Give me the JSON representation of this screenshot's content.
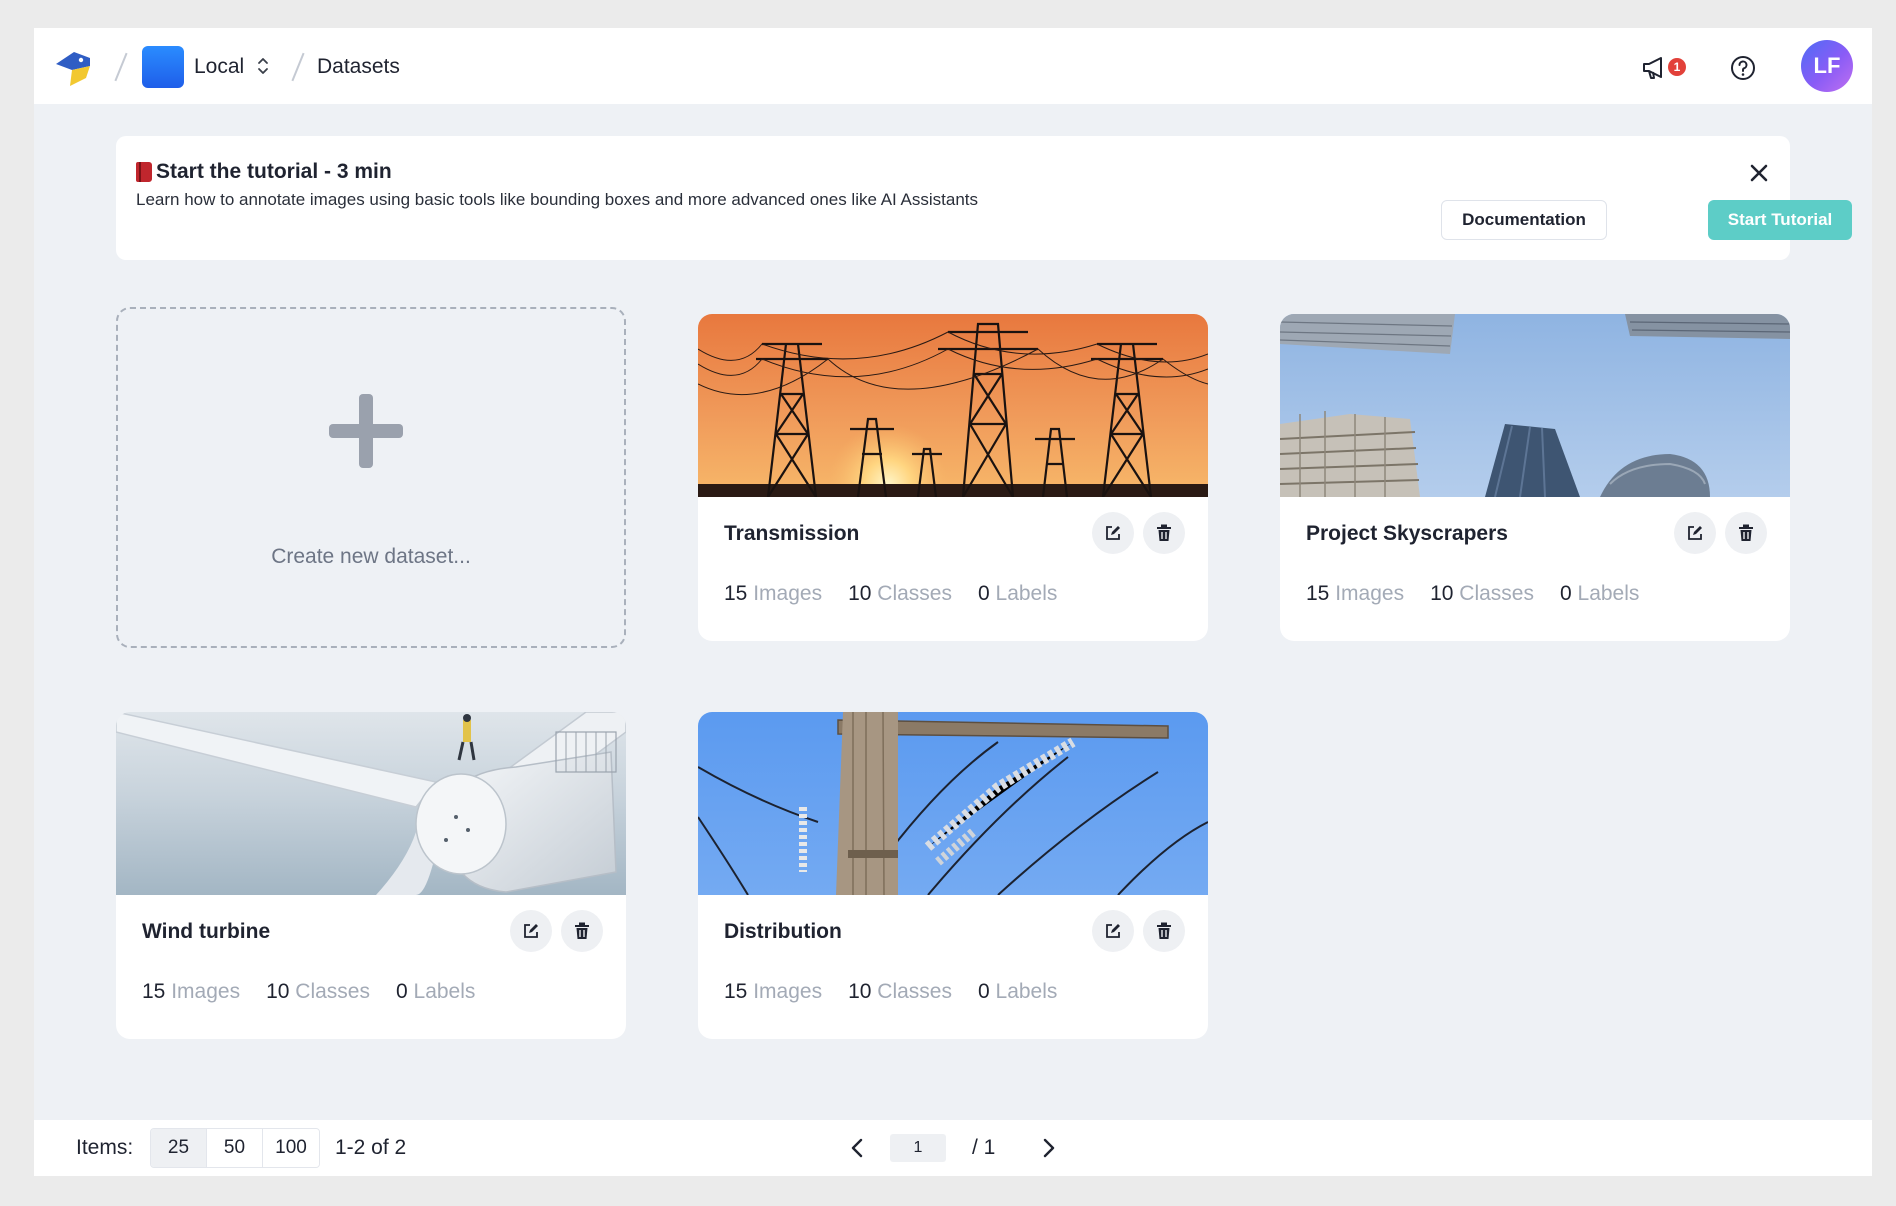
{
  "header": {
    "workspace": "Local",
    "breadcrumb": "Datasets",
    "notification_count": "1",
    "avatar_initials": "LF"
  },
  "banner": {
    "title": "Start the tutorial - 3 min",
    "description": "Learn how to annotate images using basic tools like bounding boxes and more advanced ones like AI Assistants",
    "documentation_label": "Documentation",
    "start_label": "Start Tutorial"
  },
  "create_tile": {
    "label": "Create new dataset..."
  },
  "datasets": [
    {
      "name": "Transmission",
      "images": "15",
      "classes": "10",
      "labels": "0",
      "image": "power-lines-sunset"
    },
    {
      "name": "Project Skyscrapers",
      "images": "15",
      "classes": "10",
      "labels": "0",
      "image": "skyscrapers-sky"
    },
    {
      "name": "Wind turbine",
      "images": "15",
      "classes": "10",
      "labels": "0",
      "image": "wind-turbine"
    },
    {
      "name": "Distribution",
      "images": "15",
      "classes": "10",
      "labels": "0",
      "image": "utility-pole"
    }
  ],
  "stat_labels": {
    "images": "Images",
    "classes": "Classes",
    "labels": "Labels"
  },
  "pagination": {
    "items_label": "Items:",
    "page_sizes": [
      "25",
      "50",
      "100"
    ],
    "selected_page_size": "25",
    "range_text": "1-2 of 2",
    "current_page": "1",
    "total_text": "/ 1"
  },
  "colors": {
    "accent": "#5dcdc7",
    "badge": "#e2413a",
    "workspace": "#1f5ee9"
  }
}
